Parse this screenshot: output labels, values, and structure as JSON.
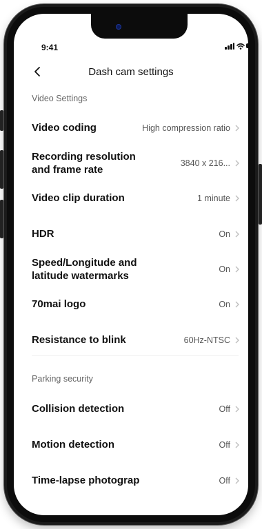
{
  "status_bar": {
    "time": "9:41"
  },
  "header": {
    "title": "Dash cam settings",
    "back_icon": "chevron-left-icon"
  },
  "sections": [
    {
      "title": "Video Settings",
      "items": [
        {
          "label": "Video coding",
          "value": "High compression ratio"
        },
        {
          "label": "Recording resolution and frame rate",
          "value": "3840 x 216..."
        },
        {
          "label": "Video clip duration",
          "value": "1 minute"
        },
        {
          "label": "HDR",
          "value": "On"
        },
        {
          "label": "Speed/Longitude and latitude watermarks",
          "value": "On"
        },
        {
          "label": "70mai logo",
          "value": "On"
        },
        {
          "label": "Resistance to blink",
          "value": "60Hz-NTSC"
        }
      ]
    },
    {
      "title": "Parking security",
      "items": [
        {
          "label": "Collision detection",
          "value": "Off"
        },
        {
          "label": "Motion detection",
          "value": "Off"
        },
        {
          "label": "Time-lapse photograp",
          "value": "Off"
        }
      ]
    }
  ],
  "colors": {
    "text": "#111111",
    "secondary": "#555555",
    "chevron": "#bdbdbd",
    "frame": "#1b1b1b"
  }
}
